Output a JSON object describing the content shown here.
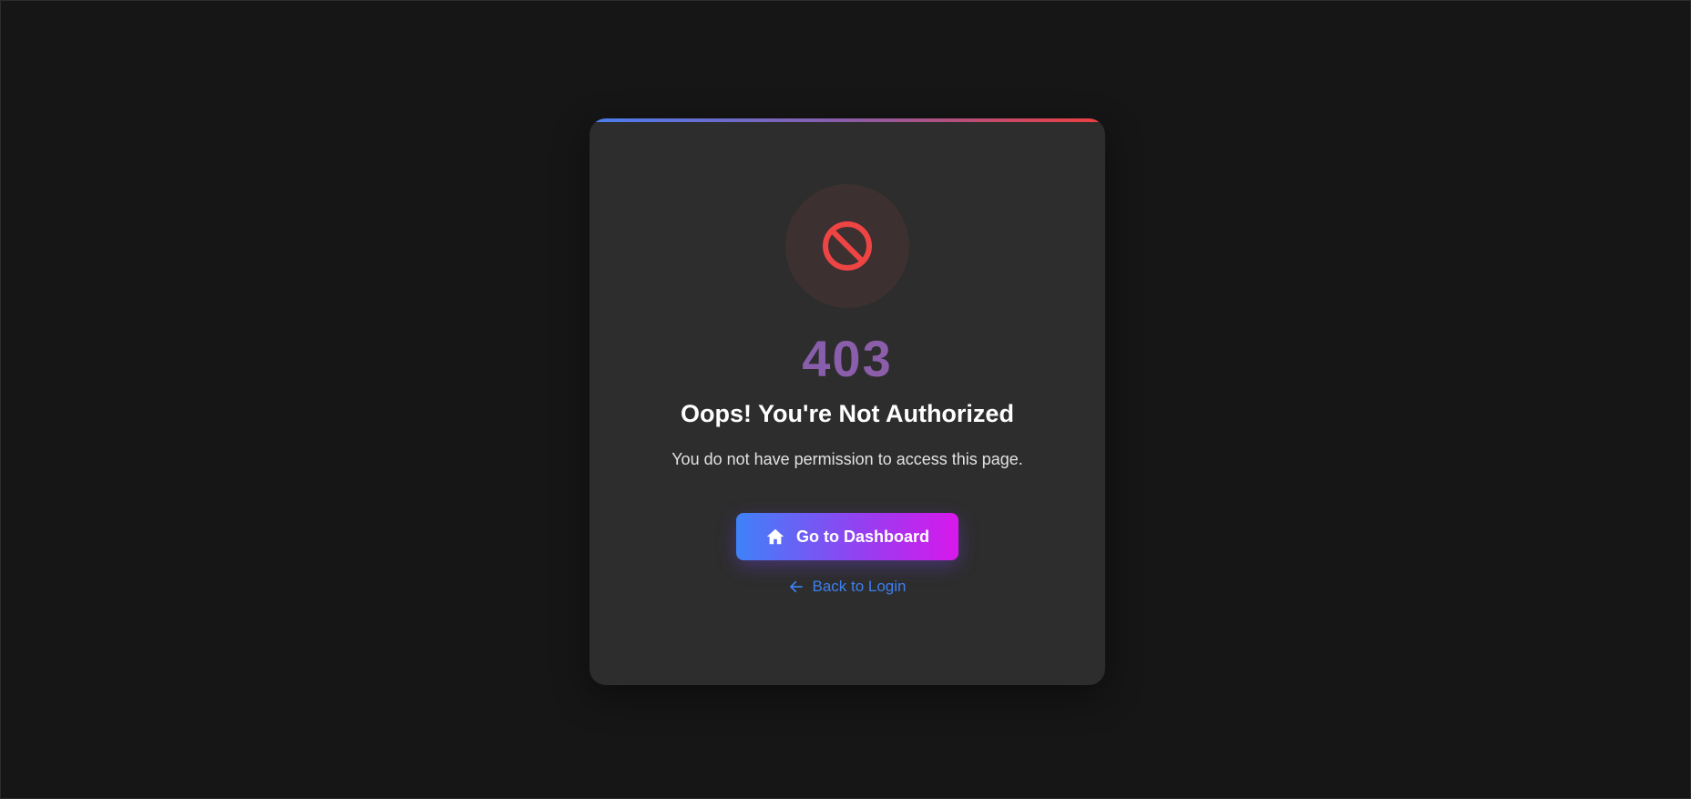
{
  "error": {
    "code": "403",
    "headline": "Oops! You're Not Authorized",
    "message": "You do not have permission to access this page."
  },
  "actions": {
    "primary_label": "Go to Dashboard",
    "primary_icon": "home-icon",
    "secondary_label": "Back to Login",
    "secondary_icon": "arrow-left-icon"
  },
  "colors": {
    "background": "#161616",
    "card": "#2d2d2d",
    "error_icon": "#ef4444",
    "link": "#3d7ff0",
    "button_gradient_start": "#3f82f8",
    "button_gradient_end": "#d818ec"
  },
  "icons": {
    "status": "block-icon"
  }
}
